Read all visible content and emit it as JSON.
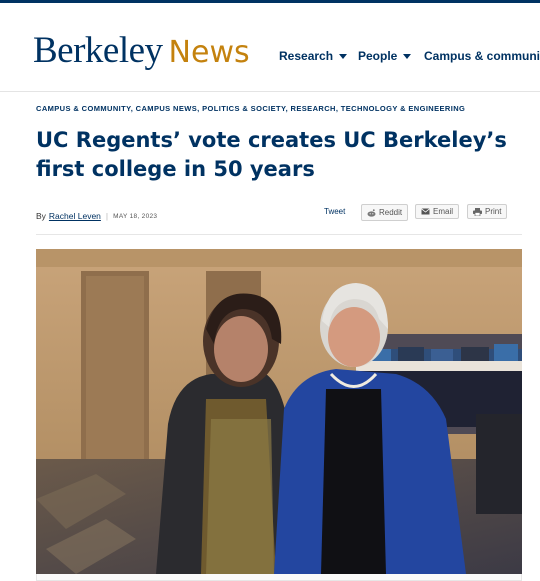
{
  "header": {
    "logo_primary": "Berkeley",
    "logo_secondary": "News",
    "nav": [
      {
        "label": "Research",
        "has_dropdown": true
      },
      {
        "label": "People",
        "has_dropdown": true
      },
      {
        "label": "Campus & community",
        "has_dropdown": false
      }
    ]
  },
  "article": {
    "categories": "CAMPUS & COMMUNITY, CAMPUS NEWS, POLITICS & SOCIETY, RESEARCH, TECHNOLOGY & ENGINEERING",
    "headline": "UC Regents’ vote creates UC Berkeley’s first college in 50 years",
    "byline_prefix": "By",
    "author": "Rachel Leven",
    "date": "MAY 18, 2023"
  },
  "share": {
    "tweet": "Tweet",
    "reddit": "Reddit",
    "email": "Email",
    "print": "Print"
  },
  "colors": {
    "brand_blue": "#003262",
    "brand_gold": "#c4820e"
  },
  "icons": [
    "chevron-down-icon",
    "reddit-icon",
    "email-icon",
    "print-icon"
  ]
}
